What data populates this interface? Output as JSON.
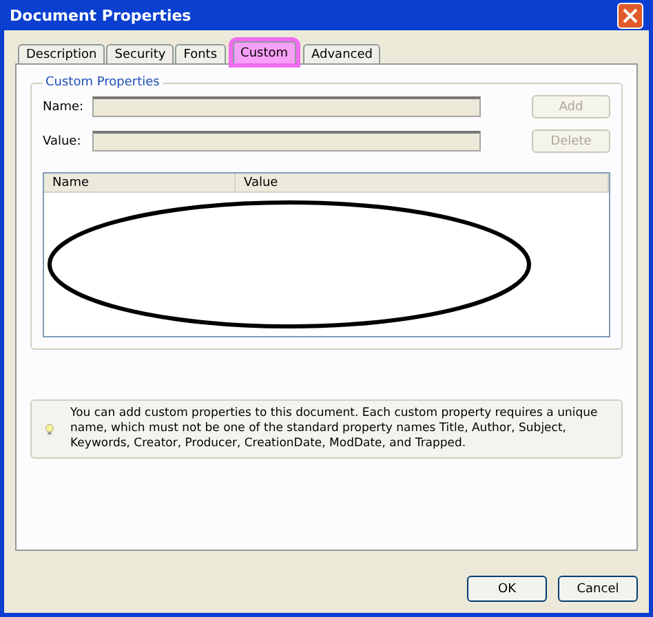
{
  "window": {
    "title": "Document Properties"
  },
  "tabs": [
    {
      "label": "Description",
      "selected": false,
      "highlighted": false
    },
    {
      "label": "Security",
      "selected": false,
      "highlighted": false
    },
    {
      "label": "Fonts",
      "selected": false,
      "highlighted": false
    },
    {
      "label": "Custom",
      "selected": true,
      "highlighted": true
    },
    {
      "label": "Advanced",
      "selected": false,
      "highlighted": false
    }
  ],
  "group": {
    "title": "Custom Properties",
    "fields": [
      {
        "label": "Name:",
        "button": "Add",
        "disabled": true
      },
      {
        "label": "Value:",
        "button": "Delete",
        "disabled": true
      }
    ]
  },
  "table": {
    "columns": [
      "Name",
      "Value"
    ],
    "circled": true
  },
  "info": {
    "text": "You can add custom properties to this document. Each custom property requires a unique name, which must not be one of the standard property names Title, Author, Subject, Keywords, Creator, Producer, CreationDate, ModDate, and Trapped."
  },
  "footer": {
    "buttons": [
      "OK",
      "Cancel"
    ]
  }
}
